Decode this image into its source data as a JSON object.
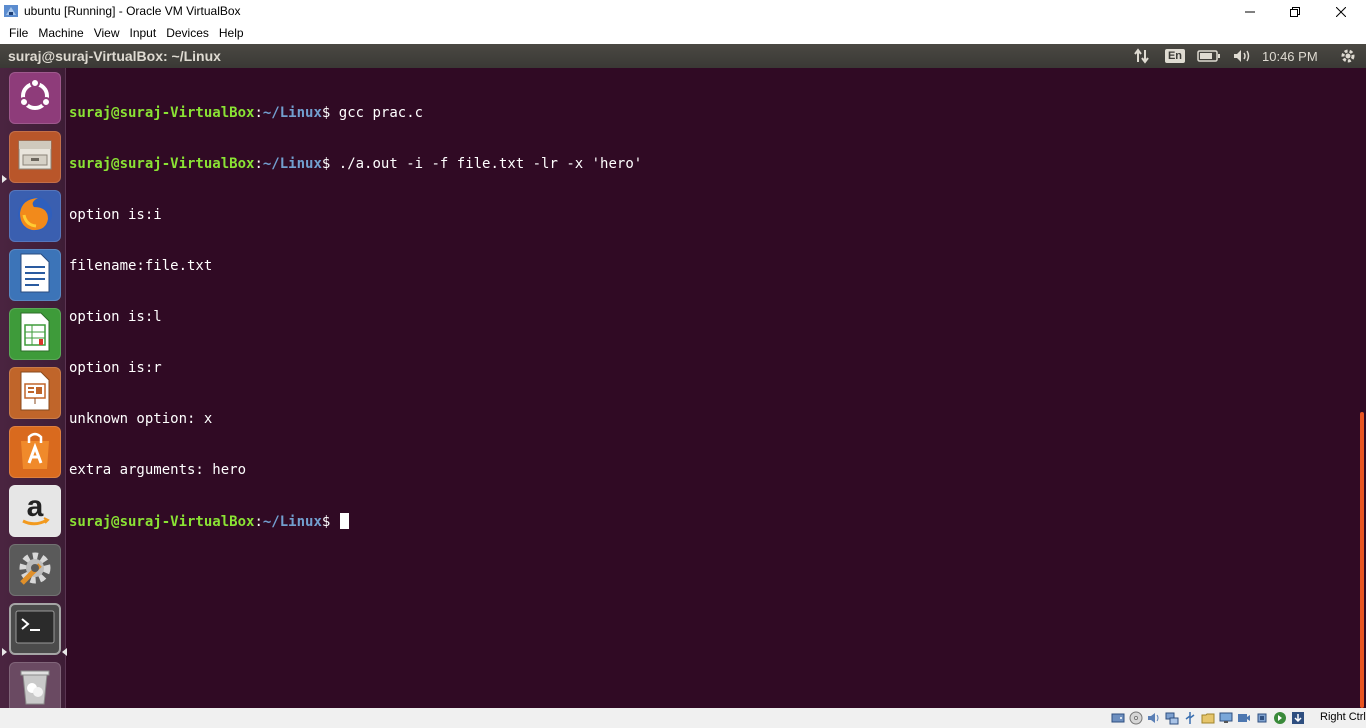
{
  "host_window": {
    "title": "ubuntu [Running] - Oracle VM VirtualBox",
    "menu": [
      "File",
      "Machine",
      "View",
      "Input",
      "Devices",
      "Help"
    ],
    "host_key_label": "Right Ctrl"
  },
  "panel": {
    "window_title": "suraj@suraj-VirtualBox: ~/Linux",
    "language": "En",
    "clock": "10:46 PM"
  },
  "launcher": {
    "items": [
      {
        "icon": "ubuntu-dash-icon"
      },
      {
        "icon": "files-icon"
      },
      {
        "icon": "firefox-icon"
      },
      {
        "icon": "libreoffice-writer-icon"
      },
      {
        "icon": "libreoffice-calc-icon"
      },
      {
        "icon": "libreoffice-impress-icon"
      },
      {
        "icon": "software-center-icon"
      },
      {
        "icon": "amazon-icon"
      },
      {
        "icon": "system-settings-icon"
      },
      {
        "icon": "terminal-icon"
      },
      {
        "icon": "trash-icon"
      }
    ]
  },
  "terminal": {
    "user_host": "suraj@suraj-VirtualBox",
    "separator": ":",
    "path": "~/Linux",
    "prompt_symbol": "$",
    "commands": [
      "gcc prac.c",
      "./a.out -i -f file.txt -lr -x 'hero'"
    ],
    "output": [
      "option is:i",
      "filename:file.txt",
      "option is:l",
      "option is:r",
      "unknown option: x",
      "extra arguments: hero"
    ]
  },
  "colors": {
    "terminal_bg": "#300a24",
    "prompt_user": "#8ae234",
    "prompt_path": "#729fcf",
    "panel_bg": "#3c3b37",
    "accent": "#e95420"
  }
}
